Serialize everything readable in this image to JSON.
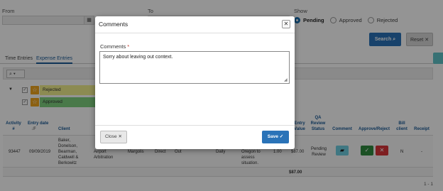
{
  "filters": {
    "from_label": "From",
    "to_label": "To",
    "show_label": "Show",
    "show_options": [
      {
        "label": "Pending",
        "selected": true
      },
      {
        "label": "Approved",
        "selected": false
      },
      {
        "label": "Rejected",
        "selected": false
      }
    ],
    "search_label": "Search",
    "reset_label": "Reset"
  },
  "tabs": [
    "Time Entries",
    "Expense Entries"
  ],
  "groups": [
    {
      "label": "Rejected",
      "color": "#f1ef8d"
    },
    {
      "label": "Approved",
      "color": "#7fd17f"
    }
  ],
  "grid": {
    "headers": {
      "activity": "Activity #",
      "entry_date": "Entry date",
      "sort_arrow": "↓F",
      "client": "Client",
      "entry_value": "Entry Value",
      "qa_review_status": "QA Review Status",
      "comment": "Comment",
      "approve_reject": "Approve/Reject",
      "bill_client": "Bill client",
      "receipt": "Receipt"
    },
    "row": {
      "activity": "93447",
      "entry_date": "09/09/2019",
      "client": "Baker, Donelson, Bearman, Caldwell & Berkowitz",
      "partial_a": "Airport Arbitration",
      "partial_b": "Margolis",
      "partial_c": "Direct",
      "partial_d": "Out",
      "partial_e": "-",
      "partial_f": "Daily",
      "partial_g": "Oregon to assess situation.",
      "partial_h": "1.00",
      "entry_value": "$87.00",
      "qa_review_status": "Pending Review",
      "bill_client": "N",
      "receipt": "-"
    },
    "total": "$87.00",
    "pager": "1 - 1"
  },
  "modal": {
    "title": "Comments",
    "field_label": "Comments",
    "required_mark": "*",
    "value": "Sorry about leaving out context.",
    "close_label": "Close",
    "save_label": "Save"
  }
}
